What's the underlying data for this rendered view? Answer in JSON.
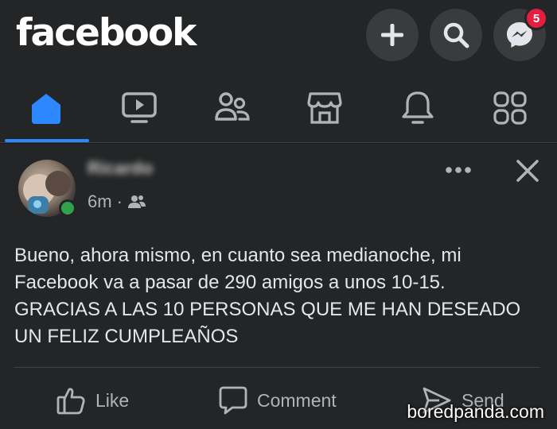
{
  "header": {
    "logo": "facebook",
    "buttons": [
      {
        "icon": "plus-icon"
      },
      {
        "icon": "search-icon"
      },
      {
        "icon": "messenger-icon",
        "badge": "5"
      }
    ]
  },
  "nav": {
    "active": "home",
    "tabs": [
      {
        "icon": "home-icon"
      },
      {
        "icon": "watch-icon"
      },
      {
        "icon": "friends-icon"
      },
      {
        "icon": "marketplace-icon"
      },
      {
        "icon": "notifications-icon"
      },
      {
        "icon": "menu-icon"
      }
    ]
  },
  "post": {
    "author": "Ricardo",
    "time": "6m",
    "separator": "·",
    "audience_icon": "friends-audience-icon",
    "text": "Bueno, ahora mismo, en cuanto sea medianoche, mi\nFacebook va a pasar de 290 amigos a unos 10-15.\nGRACIAS A LAS 10 PERSONAS QUE ME HAN DESEADO\nUN FELIZ CUMPLEAÑOS",
    "actions": {
      "like": "Like",
      "comment": "Comment",
      "send": "Send"
    }
  },
  "watermark": "boredpanda.com",
  "colors": {
    "background": "#18191a",
    "surface": "#242526",
    "accent": "#2d88ff",
    "badge": "#e41e3f",
    "online": "#31a24c"
  }
}
